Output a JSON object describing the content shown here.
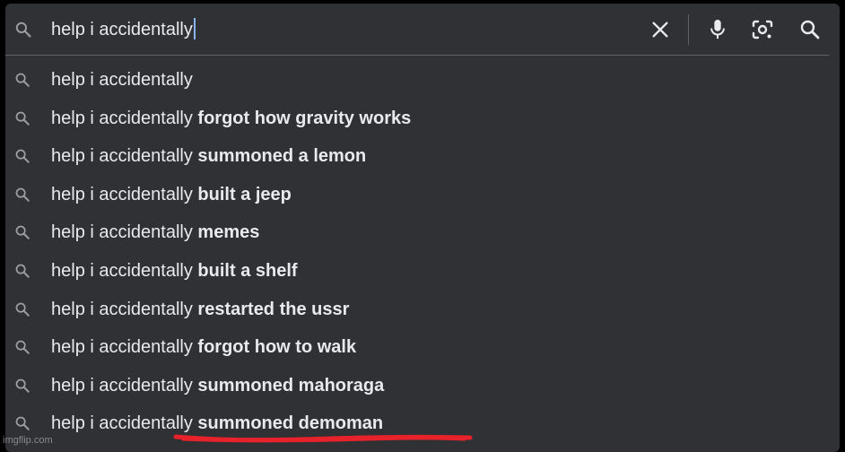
{
  "search": {
    "query": "help i accidentally",
    "icons": {
      "leading": "search-icon",
      "clear": "close-icon",
      "voice": "microphone-icon",
      "lens": "camera-lens-icon",
      "submit": "search-icon"
    }
  },
  "suggestions": [
    {
      "prefix": "help i accidentally",
      "completion": ""
    },
    {
      "prefix": "help i accidentally",
      "completion": " forgot how gravity works"
    },
    {
      "prefix": "help i accidentally",
      "completion": " summoned a lemon"
    },
    {
      "prefix": "help i accidentally",
      "completion": " built a jeep"
    },
    {
      "prefix": "help i accidentally",
      "completion": " memes"
    },
    {
      "prefix": "help i accidentally",
      "completion": " built a shelf"
    },
    {
      "prefix": "help i accidentally",
      "completion": " restarted the ussr"
    },
    {
      "prefix": "help i accidentally",
      "completion": " forgot how to walk"
    },
    {
      "prefix": "help i accidentally",
      "completion": " summoned mahoraga"
    },
    {
      "prefix": "help i accidentally",
      "completion": " summoned demoman"
    }
  ],
  "watermark": "imgflip.com",
  "colors": {
    "background": "#303134",
    "text": "#e8eaed",
    "icon": "#9aa0a6",
    "caret": "#8ab4f8",
    "annotation": "#e8222a"
  }
}
